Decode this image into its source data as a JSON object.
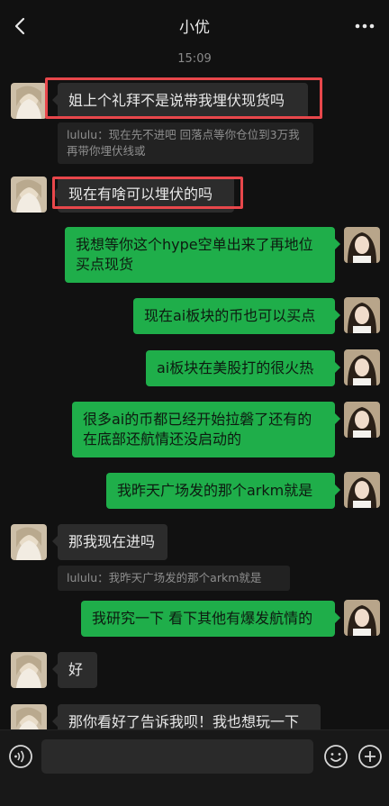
{
  "header": {
    "title": "小优"
  },
  "time": "15:09",
  "messages": [
    {
      "text": "姐上个礼拜不是说带我埋伏现货吗"
    },
    {
      "text": "lululu：现在先不进吧 回落点等你仓位到3万我再带你埋伏线或"
    },
    {
      "text": "现在有啥可以埋伏的吗"
    },
    {
      "text": "我想等你这个hype空单出来了再地位买点现货"
    },
    {
      "text": "现在ai板块的币也可以买点"
    },
    {
      "text": "ai板块在美股打的很火热"
    },
    {
      "text": "很多ai的币都已经开始拉磐了还有的在底部还航情还没启动的"
    },
    {
      "text": "我昨天广场发的那个arkm就是"
    },
    {
      "text": "那我现在进吗"
    },
    {
      "text": "lululu：我昨天广场发的那个arkm就是"
    },
    {
      "text": "我研究一下 看下其他有爆发航情的"
    },
    {
      "text": "好"
    },
    {
      "text": "那你看好了告诉我呗！我也想玩一下"
    }
  ],
  "input": {
    "placeholder": ""
  },
  "colors": {
    "background": "#111111",
    "bubble_left": "#2c2c2c",
    "bubble_right": "#1fae4a",
    "highlight": "#e8474b"
  },
  "icons": {
    "back": "chevron-left-icon",
    "more": "more-dots-icon",
    "voice": "voice-icon",
    "emoji": "emoji-icon",
    "plus": "plus-icon"
  }
}
